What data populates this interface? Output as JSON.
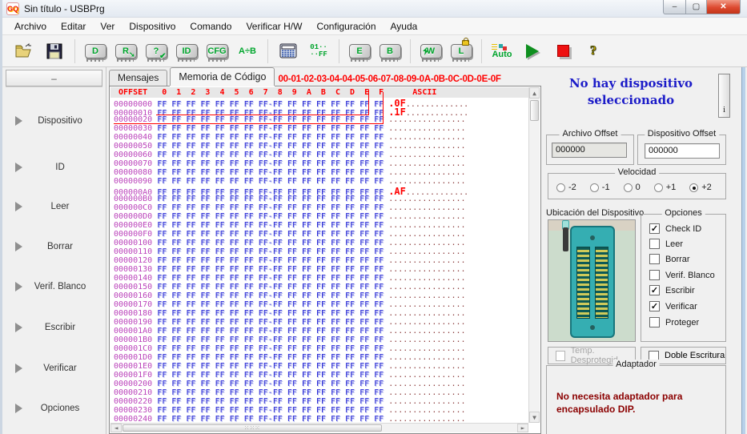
{
  "window": {
    "title": "Sin título - USBPrg",
    "controls": {
      "minimize": "–",
      "maximize": "▢",
      "close": "✕"
    }
  },
  "menu": {
    "items": [
      "Archivo",
      "Editar",
      "Ver",
      "Dispositivo",
      "Comando",
      "Verificar H/W",
      "Configuración",
      "Ayuda"
    ]
  },
  "toolbar": {
    "buttons": [
      {
        "name": "open",
        "icon": "folder"
      },
      {
        "name": "save",
        "icon": "floppy"
      },
      {
        "sep": true
      },
      {
        "name": "device-select",
        "icon": "chip",
        "label": "D"
      },
      {
        "name": "read-device",
        "icon": "chip",
        "label": "R",
        "overlay": "arrow"
      },
      {
        "name": "verify-device",
        "icon": "chip",
        "label": "?",
        "overlay": "check"
      },
      {
        "name": "read-id",
        "icon": "chip",
        "label": "ID"
      },
      {
        "name": "config",
        "icon": "chip",
        "label": "CFG"
      },
      {
        "name": "compare",
        "icon": "text",
        "label": "A÷B"
      },
      {
        "sep": true
      },
      {
        "name": "calculator",
        "icon": "calc"
      },
      {
        "name": "fill-buffer",
        "icon": "fill",
        "label": "01··",
        "label2": "··FF"
      },
      {
        "sep": true
      },
      {
        "name": "erase",
        "icon": "chip",
        "label": "E"
      },
      {
        "name": "blank-check",
        "icon": "chip",
        "label": "B"
      },
      {
        "sep": true
      },
      {
        "name": "write",
        "icon": "chip",
        "label": "W",
        "overlay": "bolt"
      },
      {
        "name": "lock",
        "icon": "chip",
        "label": "L",
        "overlay": "lock"
      },
      {
        "sep": true
      },
      {
        "name": "auto",
        "icon": "auto",
        "label": "Auto"
      },
      {
        "name": "run",
        "icon": "play"
      },
      {
        "name": "stop",
        "icon": "stop"
      },
      {
        "name": "help",
        "icon": "help",
        "label": "?"
      }
    ]
  },
  "sidebar": {
    "collapse_label": "–",
    "items": [
      "Dispositivo",
      "ID",
      "Leer",
      "Borrar",
      "Verif. Blanco",
      "Escribir",
      "Verificar",
      "Opciones"
    ]
  },
  "tabs": [
    {
      "label": "Mensajes",
      "active": false
    },
    {
      "label": "Memoria de Código",
      "active": true
    }
  ],
  "hex_banner": "00-01-02-03-04-04-05-06-07-08-09-0A-0B-0C-0D-0E-0F",
  "hex_view": {
    "offset_label": "OFFSET",
    "columns": [
      "0",
      "1",
      "2",
      "3",
      "4",
      "5",
      "6",
      "7",
      "8",
      "9",
      "A",
      "B",
      "C",
      "D",
      "E",
      "F"
    ],
    "ascii_label": "ASCII",
    "byte_row": "FF FF FF FF FF FF FF FF-FF FF FF FF FF FF FF FF",
    "ascii_row": "................",
    "offsets": [
      "00000000",
      "00000010",
      "00000020",
      "00000030",
      "00000040",
      "00000050",
      "00000060",
      "00000070",
      "00000080",
      "00000090",
      "000000A0",
      "000000B0",
      "000000C0",
      "000000D0",
      "000000E0",
      "000000F0",
      "00000100",
      "00000110",
      "00000120",
      "00000130",
      "00000140",
      "00000150",
      "00000160",
      "00000170",
      "00000180",
      "00000190",
      "000001A0",
      "000001B0",
      "000001C0",
      "000001D0",
      "000001E0",
      "000001F0",
      "00000200",
      "00000210",
      "00000220",
      "00000230",
      "00000240"
    ],
    "annotations": {
      "00000000": "0F",
      "00000010": "1F",
      "000000A0": "AF"
    }
  },
  "right_panel": {
    "status_message": "No hay dispositivo seleccionado",
    "info_button_label": "i",
    "archivo_offset": {
      "label": "Archivo Offset",
      "value": "000000"
    },
    "dispositivo_offset": {
      "label": "Dispositivo Offset",
      "value": "000000"
    },
    "velocidad": {
      "label": "Velocidad",
      "options": [
        "-2",
        "-1",
        "0",
        "+1",
        "+2"
      ],
      "selected": "+2"
    },
    "ubicacion_label": "Ubicación del Dispositivo",
    "opciones": {
      "label": "Opciones",
      "items": [
        {
          "label": "Check ID",
          "checked": true
        },
        {
          "label": "Leer",
          "checked": false
        },
        {
          "label": "Borrar",
          "checked": false
        },
        {
          "label": "Verif. Blanco",
          "checked": false
        },
        {
          "label": "Escribir",
          "checked": true
        },
        {
          "label": "Verificar",
          "checked": true
        },
        {
          "label": "Proteger",
          "checked": false
        }
      ]
    },
    "temp_desprotegido": {
      "label": "Temp. Desprotegid",
      "checked": false,
      "disabled": true
    },
    "doble_escritura": {
      "label": "Doble Escritura",
      "checked": false
    },
    "adaptador": {
      "label": "Adaptador",
      "message": "No necesita adaptador para encapsulado DIP."
    }
  },
  "colors": {
    "status_blue": "#1c1cc8",
    "hex_offset": "#bb44bb",
    "hex_byte": "#2b2bd6",
    "hex_ascii": "#8a3a3a",
    "alert_red": "#ff0000",
    "adapter_red": "#8b0000",
    "toolbar_green": "#00a42c",
    "zif_teal": "#35aeb2"
  }
}
